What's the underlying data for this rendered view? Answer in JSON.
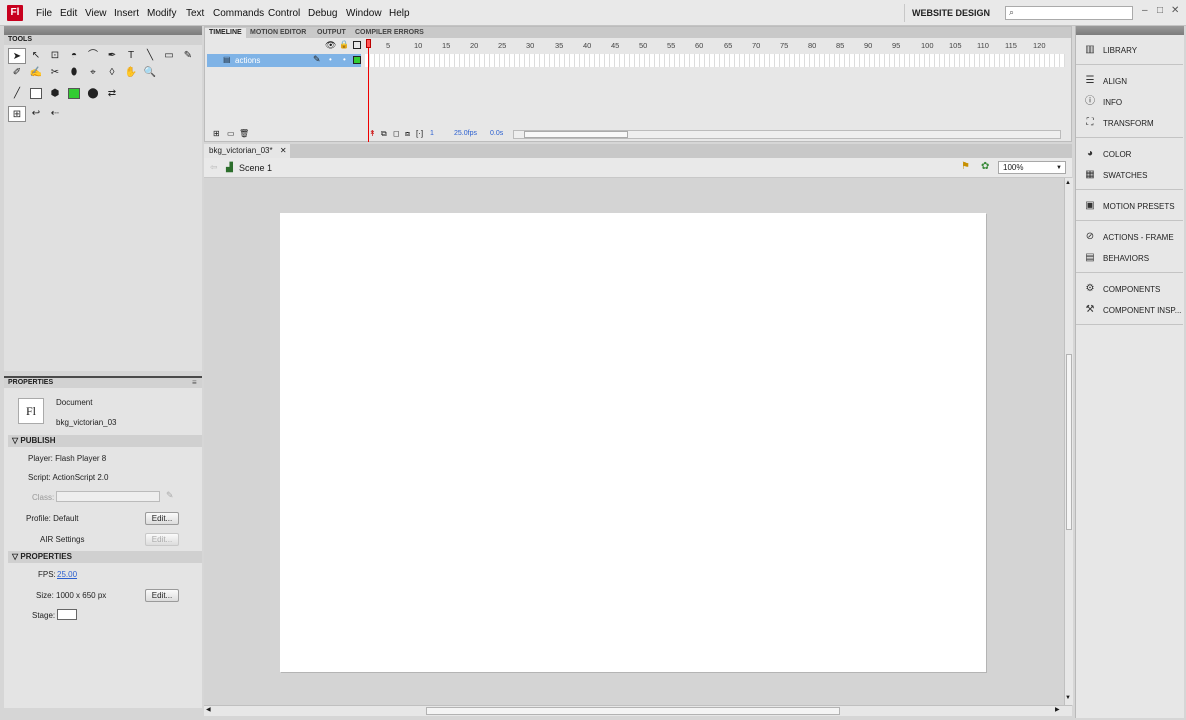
{
  "app": {
    "logo": "Fl",
    "menus": [
      "File",
      "Edit",
      "View",
      "Insert",
      "Modify",
      "Text",
      "Commands",
      "Control",
      "Debug",
      "Window",
      "Help"
    ],
    "workspace": "WEBSITE DESIGN",
    "win_controls": [
      "–",
      "□",
      "✕"
    ]
  },
  "tools_panel": {
    "title": "TOOLS",
    "row1": [
      "➤",
      "↖",
      "⊡",
      "◓",
      "⌒",
      "✒",
      "T",
      "╲",
      "▭",
      "✎"
    ],
    "row2": [
      "✐",
      "✍",
      "✂",
      "⬮",
      "⌖",
      "◊",
      "✋",
      "🔍"
    ],
    "row3": [
      "╱",
      "▯",
      "⬢",
      "▪",
      "⬤",
      "⇄"
    ],
    "row4": [
      "⊞",
      "↩",
      "⇠"
    ],
    "stroke_color": "#ffffff",
    "fill_color": "#33cc33"
  },
  "properties": {
    "title": "PROPERTIES",
    "doc_icon": "Fl",
    "doc_type": "Document",
    "doc_name": "bkg_victorian_03",
    "publish_header": "PUBLISH",
    "player_label": "Player: Flash Player 8",
    "script_label": "Script: ActionScript 2.0",
    "class_label": "Class:",
    "profile_label": "Profile: Default",
    "air_label": "AIR Settings",
    "edit_label": "Edit...",
    "props_header": "PROPERTIES",
    "fps_label": "FPS:",
    "fps_value": "25.00",
    "size_label": "Size: 1000 x 650 px",
    "stage_label": "Stage:",
    "stage_color": "#ffffff"
  },
  "timeline": {
    "tabs": [
      "TIMELINE",
      "MOTION EDITOR",
      "OUTPUT",
      "COMPILER ERRORS"
    ],
    "frame_numbers": [
      "1",
      "5",
      "10",
      "15",
      "20",
      "25",
      "30",
      "35",
      "40",
      "45",
      "50",
      "55",
      "60",
      "65",
      "70",
      "75",
      "80",
      "85",
      "90",
      "95",
      "100",
      "105",
      "110",
      "115",
      "120"
    ],
    "layer_name": "actions",
    "current_frame": "1",
    "fps_readout": "25.0fps",
    "time_readout": "0.0s"
  },
  "document": {
    "tab_label": "bkg_victorian_03*",
    "scene_label": "Scene 1",
    "zoom": "100%"
  },
  "right_dock": {
    "items": [
      "LIBRARY",
      "ALIGN",
      "INFO",
      "TRANSFORM",
      "COLOR",
      "SWATCHES",
      "MOTION PRESETS",
      "ACTIONS - FRAME",
      "BEHAVIORS",
      "COMPONENTS",
      "COMPONENT INSP..."
    ]
  }
}
